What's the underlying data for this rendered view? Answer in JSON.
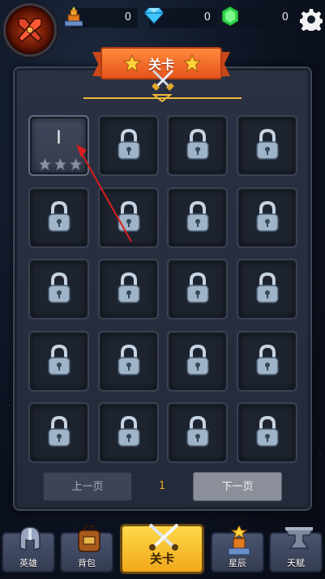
{
  "resources": [
    {
      "name": "tower-resource",
      "icon": "tower-icon",
      "value": "0"
    },
    {
      "name": "diamond-resource",
      "icon": "diamond-icon",
      "value": "0"
    },
    {
      "name": "emerald-resource",
      "icon": "emerald-icon",
      "value": "0"
    }
  ],
  "panel": {
    "title": "关卡"
  },
  "levels": [
    {
      "label": "I",
      "locked": false,
      "stars": 0,
      "max_stars": 3
    },
    {
      "locked": true
    },
    {
      "locked": true
    },
    {
      "locked": true
    },
    {
      "locked": true
    },
    {
      "locked": true
    },
    {
      "locked": true
    },
    {
      "locked": true
    },
    {
      "locked": true
    },
    {
      "locked": true
    },
    {
      "locked": true
    },
    {
      "locked": true
    },
    {
      "locked": true
    },
    {
      "locked": true
    },
    {
      "locked": true
    },
    {
      "locked": true
    },
    {
      "locked": true
    },
    {
      "locked": true
    },
    {
      "locked": true
    },
    {
      "locked": true
    }
  ],
  "pager": {
    "prev_label": "上一页",
    "page": "1",
    "next_label": "下一页"
  },
  "nav": {
    "hero_label": "英雄",
    "bag_label": "背包",
    "level_label": "关卡",
    "stars_label": "星辰",
    "talent_label": "天赋"
  },
  "colors": {
    "accent_orange": "#ff8a3d",
    "nav_active": "#ffd94a",
    "page_number": "#e5a622",
    "annotation_arrow": "#d81e1e"
  }
}
